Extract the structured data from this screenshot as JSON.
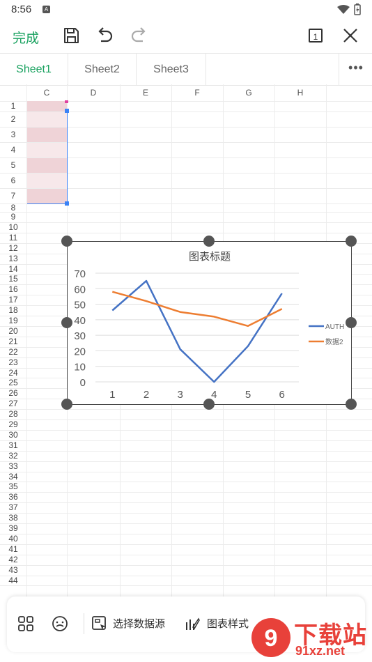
{
  "status_bar": {
    "time": "8:56"
  },
  "toolbar": {
    "done_label": "完成",
    "page_badge": "1"
  },
  "tabs": [
    {
      "label": "Sheet1",
      "active": true
    },
    {
      "label": "Sheet2",
      "active": false
    },
    {
      "label": "Sheet3",
      "active": false
    }
  ],
  "columns": [
    "C",
    "D",
    "E",
    "F",
    "G",
    "H"
  ],
  "rows": [
    "1",
    "2",
    "3",
    "4",
    "5",
    "6",
    "7",
    "8",
    "9",
    "10",
    "11",
    "12",
    "13",
    "14",
    "15",
    "16",
    "17",
    "18",
    "19",
    "20",
    "21",
    "22",
    "23",
    "24",
    "25",
    "26",
    "27",
    "28",
    "29",
    "30",
    "31",
    "32",
    "33",
    "34",
    "35",
    "36",
    "37",
    "38",
    "39",
    "40",
    "41",
    "42",
    "43",
    "44"
  ],
  "chart": {
    "title": "图表标题",
    "legend": [
      {
        "name": "AUTH",
        "color": "#4472c4"
      },
      {
        "name": "数据2",
        "color": "#ed7d31"
      }
    ]
  },
  "chart_data": {
    "type": "line",
    "title": "图表标题",
    "categories": [
      "1",
      "2",
      "3",
      "4",
      "5",
      "6"
    ],
    "series": [
      {
        "name": "AUTH",
        "color": "#4472c4",
        "values": [
          46,
          65,
          21,
          0,
          23,
          57
        ]
      },
      {
        "name": "数据2",
        "color": "#ed7d31",
        "values": [
          58,
          52,
          45,
          42,
          36,
          47
        ]
      }
    ],
    "yticks": [
      "0",
      "10",
      "20",
      "30",
      "40",
      "50",
      "60",
      "70"
    ],
    "ylim": [
      0,
      70
    ],
    "grid": true,
    "legend_position": "right"
  },
  "bottom_bar": {
    "select_data_label": "选择数据源",
    "chart_style_label": "图表样式"
  },
  "watermark": {
    "text": "下载站",
    "url": "91xz.net"
  }
}
